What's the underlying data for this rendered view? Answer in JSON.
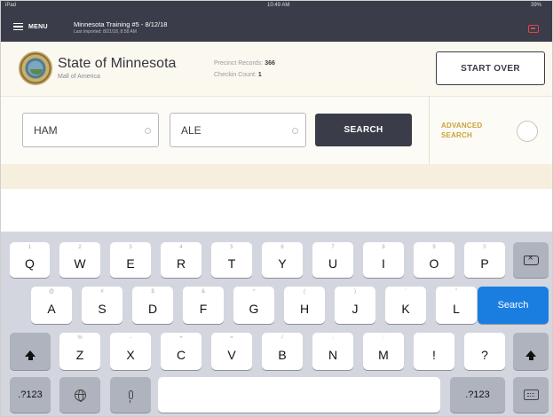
{
  "status_bar": {
    "carrier": "iPad",
    "time": "10:49 AM",
    "battery": "39%"
  },
  "app_bar": {
    "menu_label": "MENU",
    "session_title": "Minnesota Training #5 - 8/12/18",
    "session_subtitle": "Last imported: 8/21/18, 8:58 AM"
  },
  "header": {
    "org_name": "State of Minnesota",
    "org_location": "Mall of America",
    "precinct_label": "Precinct Records:",
    "precinct_value": "366",
    "checkin_label": "Checkin Count:",
    "checkin_value": "1",
    "start_over_label": "START OVER"
  },
  "search": {
    "last_name_value": "HAM",
    "first_name_value": "ALE",
    "search_label": "SEARCH",
    "advanced_line1": "ADVANCED",
    "advanced_line2": "SEARCH",
    "advanced_enabled": false
  },
  "colors": {
    "app_bar": "#3a3c49",
    "accent_gold": "#c8a437",
    "header_bg": "#fbf8ef",
    "keyboard_bg": "#d3d6de",
    "search_key": "#1a7ee0"
  },
  "keyboard": {
    "row1": [
      {
        "letter": "Q",
        "hint": "1"
      },
      {
        "letter": "W",
        "hint": "2"
      },
      {
        "letter": "E",
        "hint": "3"
      },
      {
        "letter": "R",
        "hint": "4"
      },
      {
        "letter": "T",
        "hint": "5"
      },
      {
        "letter": "Y",
        "hint": "6"
      },
      {
        "letter": "U",
        "hint": "7"
      },
      {
        "letter": "I",
        "hint": "8"
      },
      {
        "letter": "O",
        "hint": "9"
      },
      {
        "letter": "P",
        "hint": "0"
      }
    ],
    "row2": [
      {
        "letter": "A",
        "hint": "@"
      },
      {
        "letter": "S",
        "hint": "#"
      },
      {
        "letter": "D",
        "hint": "$"
      },
      {
        "letter": "F",
        "hint": "&"
      },
      {
        "letter": "G",
        "hint": "*"
      },
      {
        "letter": "H",
        "hint": "("
      },
      {
        "letter": "J",
        "hint": ")"
      },
      {
        "letter": "K",
        "hint": "'"
      },
      {
        "letter": "L",
        "hint": "\""
      }
    ],
    "row3": [
      {
        "letter": "Z",
        "hint": "%"
      },
      {
        "letter": "X",
        "hint": "-"
      },
      {
        "letter": "C",
        "hint": "+"
      },
      {
        "letter": "V",
        "hint": "="
      },
      {
        "letter": "B",
        "hint": "/"
      },
      {
        "letter": "N",
        "hint": ";"
      },
      {
        "letter": "M",
        "hint": ":"
      },
      {
        "letter": "!",
        "hint": ""
      },
      {
        "letter": "?",
        "hint": ""
      }
    ],
    "search_key": "Search",
    "numbers_key": ".?123",
    "icons": {
      "delete": "backspace-icon",
      "shift": "shift-icon",
      "globe": "globe-icon",
      "mic": "microphone-icon",
      "hide": "keyboard-hide-icon"
    }
  }
}
